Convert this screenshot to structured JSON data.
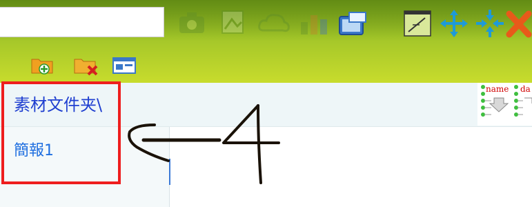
{
  "search": {
    "value": ""
  },
  "toolbar": {
    "icons": [
      "camera-icon",
      "image-icon",
      "cloud-icon",
      "grid-icon",
      "screen-icon",
      "line-chart-icon",
      "move-arrows-icon",
      "compress-arrows-icon",
      "close-x-icon"
    ],
    "sub_icons": [
      "new-folder-icon",
      "delete-folder-icon",
      "window-icon"
    ]
  },
  "breadcrumb": {
    "folder_label": "素材文件夹\\"
  },
  "list": {
    "items": [
      {
        "label": "簡報1"
      }
    ]
  },
  "mini_panel": {
    "labels": [
      "name",
      "da"
    ]
  },
  "annotation": {
    "text": "<—4"
  }
}
